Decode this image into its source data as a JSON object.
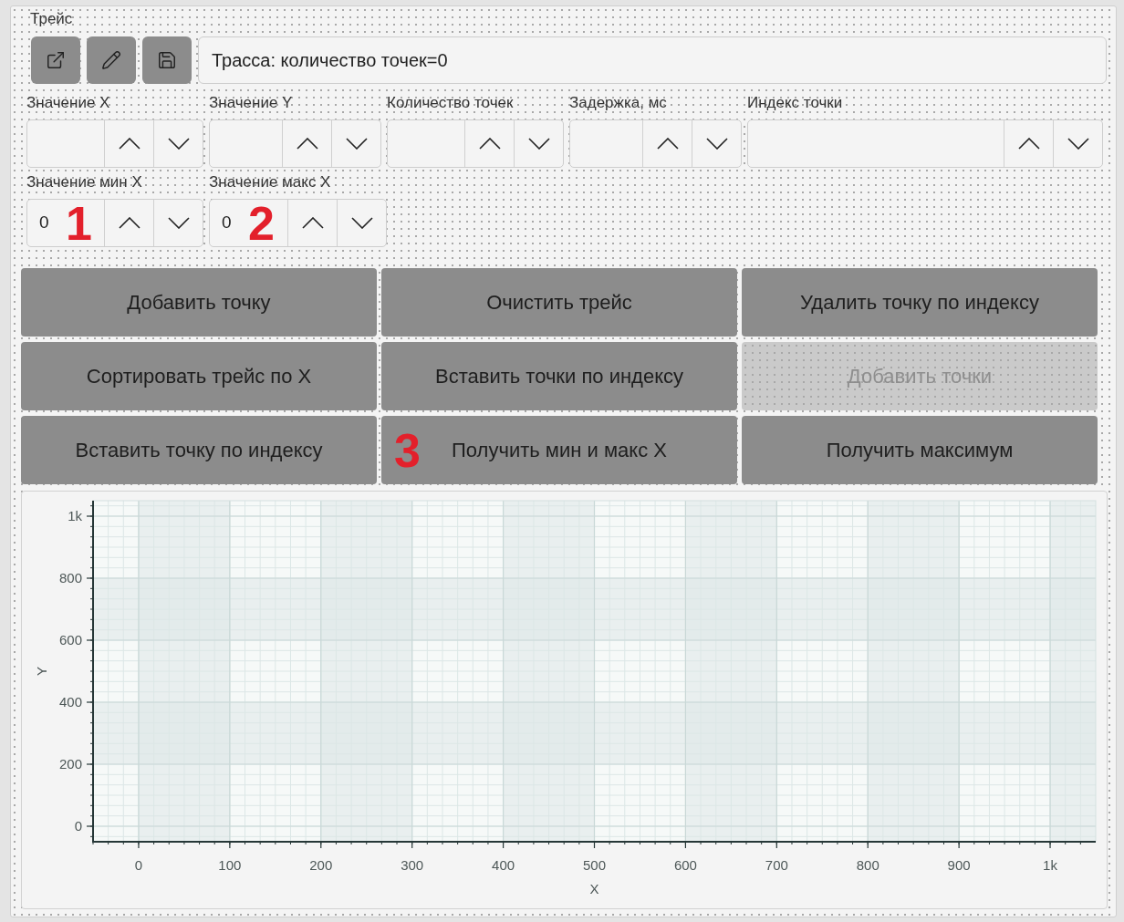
{
  "trace": {
    "title": "Трейс",
    "info_field": {
      "value": "Трасса: количество точек=0"
    }
  },
  "spin_rows": [
    [
      {
        "label": "Значение X"
      },
      {
        "label": "Значение Y"
      },
      {
        "label": "Количество точек"
      },
      {
        "label": "Задержка, мс"
      },
      {
        "label": "Индекс точки"
      }
    ],
    [
      {
        "label": "Значение мин X",
        "value": "0",
        "marker": "1"
      },
      {
        "label": "Значение макс X",
        "value": "0",
        "marker": "2"
      }
    ]
  ],
  "buttons": [
    {
      "label": "Добавить точку",
      "disabled": false
    },
    {
      "label": "Очистить трейс",
      "disabled": false
    },
    {
      "label": "Удалить точку по индексу",
      "disabled": false
    },
    {
      "label": "Сортировать трейс по X",
      "disabled": false
    },
    {
      "label": "Вставить точки по индексу",
      "disabled": false
    },
    {
      "label": "Добавить точки",
      "disabled": true
    },
    {
      "label": "Вставить точку по индексу",
      "disabled": false
    },
    {
      "label": "Получить мин и макс X",
      "disabled": false,
      "marker": "3"
    },
    {
      "label": "Получить максимум",
      "disabled": false
    }
  ],
  "chart": {
    "chart_data": {
      "type": "line",
      "xlabel": "X",
      "ylabel": "Y",
      "xlim": [
        -50,
        1050
      ],
      "ylim": [
        -50,
        1050
      ],
      "xticks": [
        0,
        100,
        200,
        300,
        400,
        500,
        600,
        700,
        800,
        900,
        {
          "value": 1000,
          "label": "1k"
        }
      ],
      "yticks": [
        0,
        200,
        400,
        600,
        800,
        {
          "value": 1000,
          "label": "1k"
        }
      ],
      "grid": true
    }
  }
}
